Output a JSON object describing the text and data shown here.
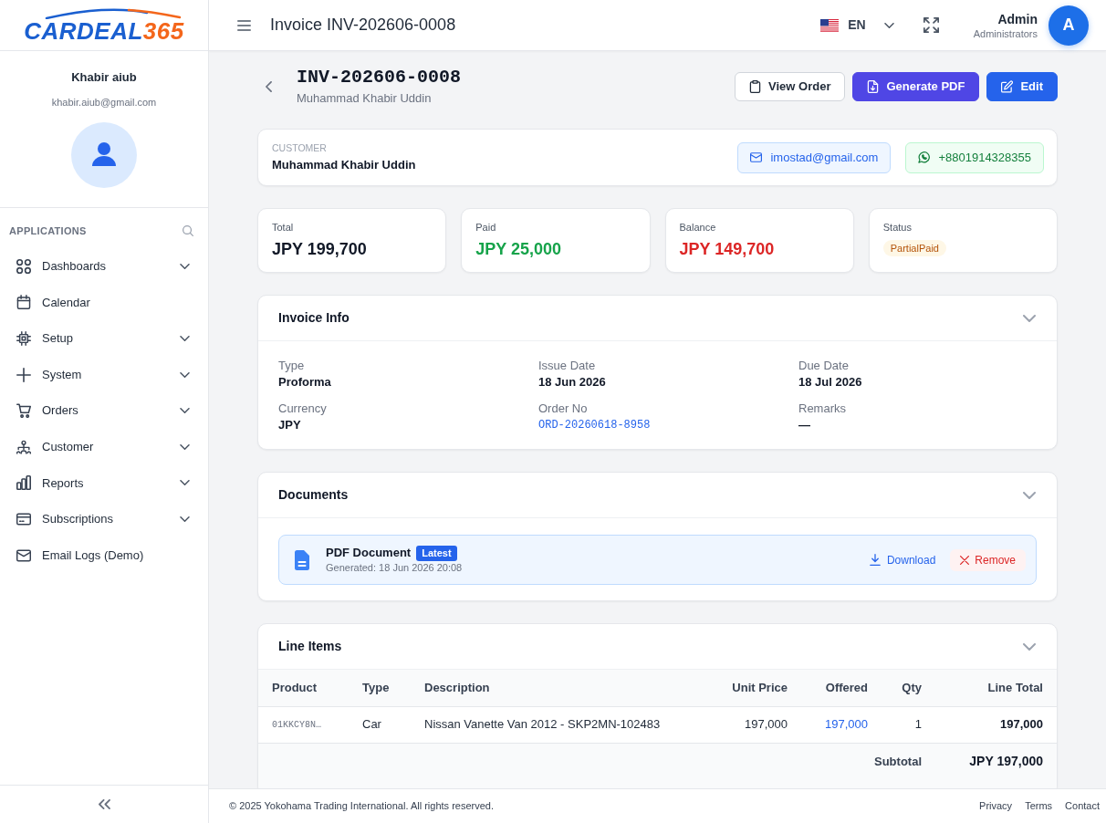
{
  "sidebar": {
    "logo": {
      "name": "CARDEAL",
      "suffix": "365"
    },
    "user": {
      "name": "Khabir aiub",
      "email": "khabir.aiub@gmail.com"
    },
    "section_title": "APPLICATIONS",
    "items": [
      {
        "label": "Dashboards",
        "has_submenu": true
      },
      {
        "label": "Calendar",
        "has_submenu": false
      },
      {
        "label": "Setup",
        "has_submenu": true
      },
      {
        "label": "System",
        "has_submenu": true
      },
      {
        "label": "Orders",
        "has_submenu": true
      },
      {
        "label": "Customer",
        "has_submenu": true
      },
      {
        "label": "Reports",
        "has_submenu": true
      },
      {
        "label": "Subscriptions",
        "has_submenu": true
      },
      {
        "label": "Email Logs (Demo)",
        "has_submenu": false
      }
    ]
  },
  "header": {
    "title": "Invoice INV-202606-0008",
    "language": "EN",
    "user": {
      "name": "Admin",
      "role": "Administrators",
      "initial": "A"
    }
  },
  "page": {
    "title": "INV-202606-0008",
    "subtitle": "Muhammad Khabir Uddin",
    "actions": [
      {
        "label": "View Order",
        "kind": "outline"
      },
      {
        "label": "Generate PDF",
        "kind": "primary"
      },
      {
        "label": "Edit",
        "kind": "accent"
      }
    ]
  },
  "customer": {
    "label": "CUSTOMER",
    "name": "Muhammad Khabir Uddin",
    "contacts": [
      {
        "kind": "email",
        "value": "imostad@gmail.com"
      },
      {
        "kind": "whatsapp",
        "value": "+8801914328355"
      }
    ]
  },
  "stats": [
    {
      "label": "Total",
      "value": "JPY 199,700",
      "kind": "amount",
      "color": "#111827"
    },
    {
      "label": "Paid",
      "value": "JPY 25,000",
      "kind": "amount",
      "color": "#16a34a"
    },
    {
      "label": "Balance",
      "value": "JPY 149,700",
      "kind": "amount",
      "color": "#dc2626"
    },
    {
      "label": "Status",
      "value": "PartialPaid",
      "kind": "status",
      "color": "#b45309"
    }
  ],
  "invoice_info": {
    "title": "Invoice Info",
    "expanded": true,
    "fields": [
      {
        "label": "Type",
        "value": "Proforma",
        "kind": "text"
      },
      {
        "label": "Issue Date",
        "value": "18 Jun 2026",
        "kind": "text"
      },
      {
        "label": "Due Date",
        "value": "18 Jul 2026",
        "kind": "text"
      },
      {
        "label": "Currency",
        "value": "JPY",
        "kind": "text"
      },
      {
        "label": "Order No",
        "value": "ORD-20260618-8958",
        "kind": "link"
      },
      {
        "label": "Remarks",
        "value": "—",
        "kind": "text"
      }
    ]
  },
  "documents": {
    "title": "Documents",
    "expanded": true,
    "items": [
      {
        "name": "PDF Document",
        "badge": "Latest",
        "generated": "Generated: 18 Jun 2026 20:08",
        "actions": [
          {
            "label": "Download",
            "kind": "link"
          },
          {
            "label": "Remove",
            "kind": "danger"
          }
        ]
      }
    ]
  },
  "line_items": {
    "title": "Line Items",
    "expanded": true,
    "columns": [
      "Product",
      "Type",
      "Description",
      "Unit Price",
      "Offered",
      "Qty",
      "Line Total"
    ],
    "rows": [
      {
        "product": "01KKCY8N…",
        "type": "Car",
        "description": "Nissan Vanette Van 2012 - SKP2MN-102483",
        "unit_price": "197,000",
        "offered": "197,000",
        "qty": "1",
        "line_total": "197,000"
      }
    ],
    "subtotal": {
      "label": "Subtotal",
      "value": "JPY 197,000"
    }
  },
  "footer": {
    "copyright": "© 2025 Yokohama Trading International. All rights reserved.",
    "links": [
      "Privacy",
      "Terms",
      "Contact"
    ]
  }
}
